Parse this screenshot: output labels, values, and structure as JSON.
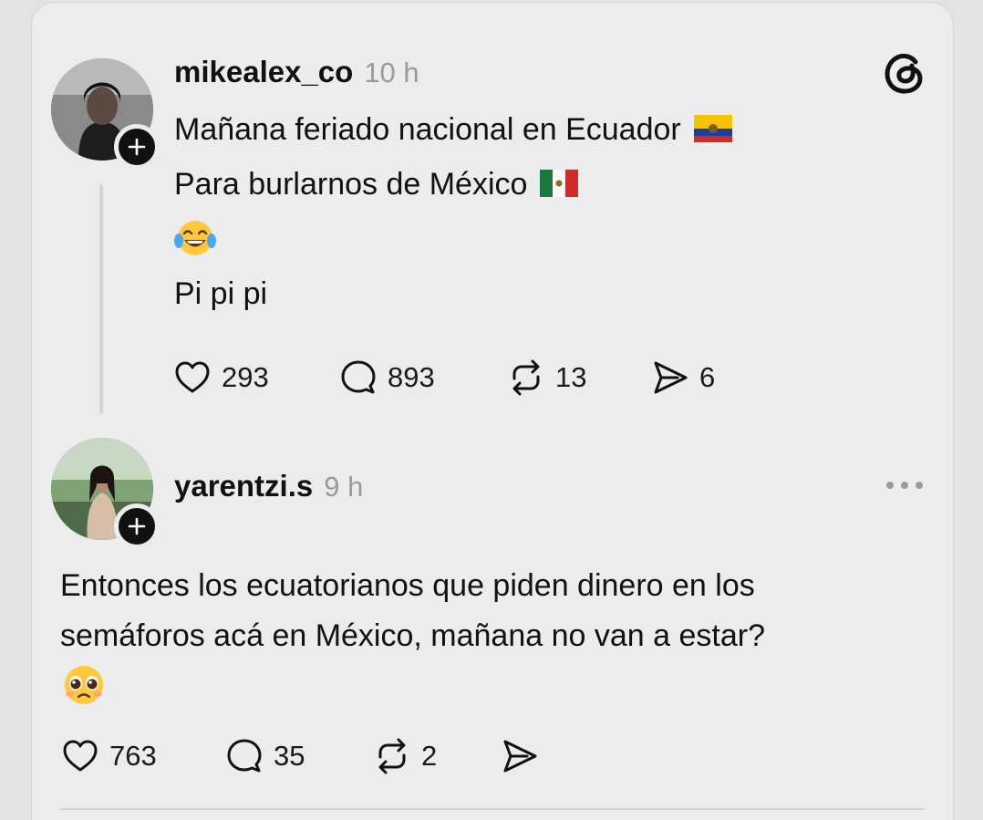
{
  "posts": [
    {
      "username": "mikealex_co",
      "time": "10 h",
      "lines": [
        "Mañana feriado nacional en Ecuador",
        "Para burlarnos de México",
        "Pi pi pi"
      ],
      "emojis": [
        "ecuador-flag-emoji",
        "mexico-flag-emoji",
        "tears-of-joy-emoji"
      ],
      "stats": {
        "likes": "293",
        "replies": "893",
        "reposts": "13",
        "shares": "6"
      }
    },
    {
      "username": "yarentzi.s",
      "time": "9 h",
      "lines": [
        "Entonces los ecuatorianos que piden dinero en los",
        "semáforos acá en México, mañana no van a estar?"
      ],
      "emojis": [
        "pleading-face-emoji"
      ],
      "stats": {
        "likes": "763",
        "replies": "35",
        "reposts": "2",
        "shares": ""
      }
    }
  ],
  "icons": [
    "threads-logo-icon",
    "plus-icon",
    "heart-icon",
    "comment-icon",
    "repost-icon",
    "share-icon",
    "more-icon"
  ],
  "colors": {
    "background": "#e3e3e3",
    "card": "#ececec",
    "text": "#111111",
    "muted": "#9a9a9a",
    "badge": "#111111"
  }
}
